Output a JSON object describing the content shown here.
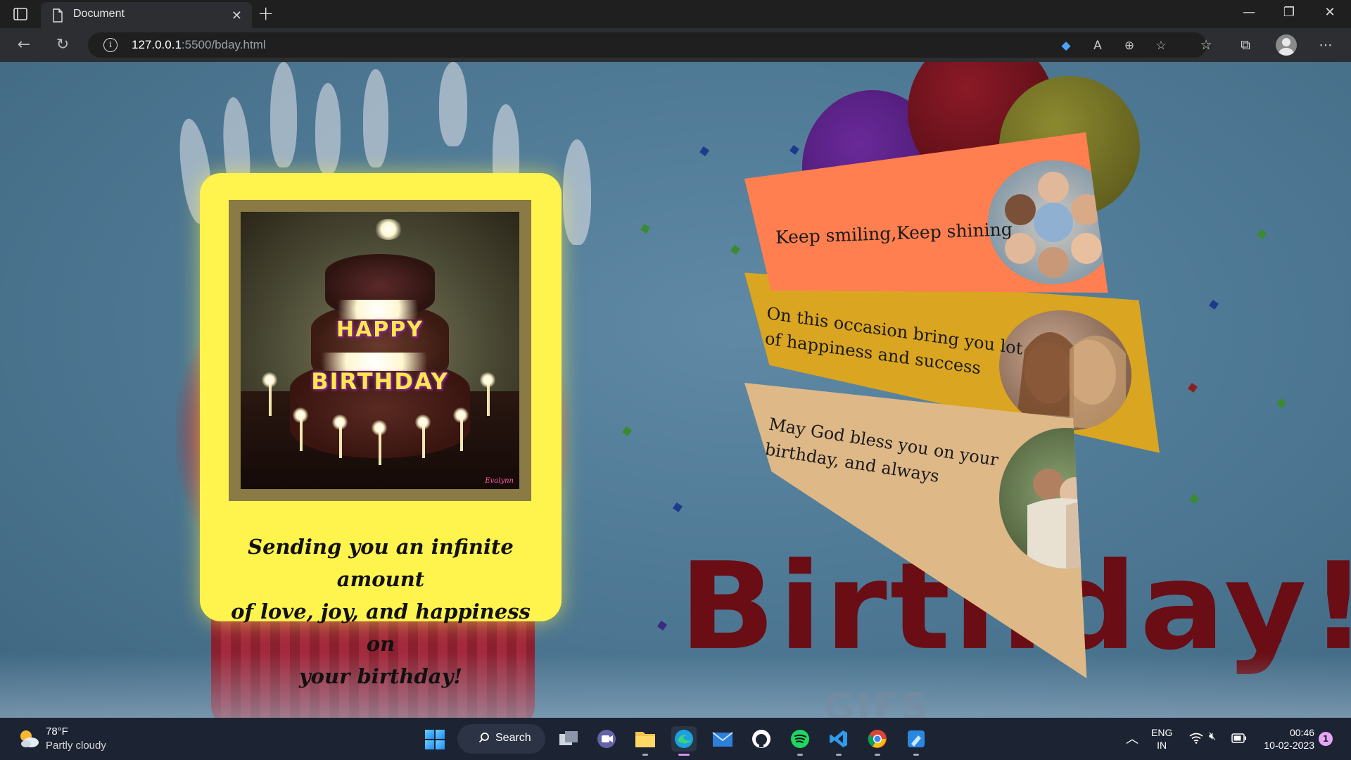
{
  "browser": {
    "tab_title": "Document",
    "url_host": "127.0.0.1",
    "url_path": ":5500/bday.html"
  },
  "page": {
    "card": {
      "cake_line1": "HAPPY",
      "cake_line2": "BIRTHDAY",
      "message_lines": [
        "Sending you an infinite amount",
        "of love, joy, and happiness on",
        "your birthday!"
      ]
    },
    "panels": [
      {
        "text": "Keep smiling,Keep shining",
        "color": "#ff7f50"
      },
      {
        "text_lines": [
          "On this occasion bring you lot",
          "of happiness and success"
        ],
        "color": "#daa520"
      },
      {
        "text_lines": [
          "May God bless you on your",
          "birthday, and always"
        ],
        "color": "#deb887"
      }
    ],
    "background_text": "Birthday!",
    "watermark": "GIFS"
  },
  "taskbar": {
    "weather_temp": "78°F",
    "weather_desc": "Partly cloudy",
    "search_label": "Search",
    "lang_line1": "ENG",
    "lang_line2": "IN",
    "time": "00:46",
    "date": "10-02-2023",
    "notification_count": "1"
  },
  "colors": {
    "card_bg": "#fff34d",
    "taskbar_bg": "#1c2333",
    "chrome_bg": "#2d2e31"
  }
}
